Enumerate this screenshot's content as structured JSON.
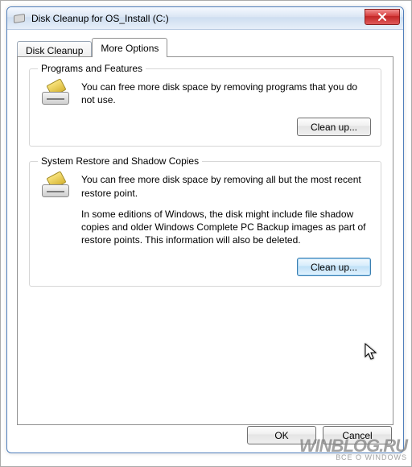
{
  "window": {
    "title": "Disk Cleanup for OS_Install (C:)"
  },
  "tabs": {
    "inactive_label": "Disk Cleanup",
    "active_label": "More Options"
  },
  "group_programs": {
    "legend": "Programs and Features",
    "text": "You can free more disk space by removing programs that you do not use.",
    "button": "Clean up..."
  },
  "group_restore": {
    "legend": "System Restore and Shadow Copies",
    "text1": "You can free more disk space by removing all but the most recent restore point.",
    "text2": "In some editions of Windows, the disk might include file shadow copies and older Windows Complete PC Backup images as part of restore points. This information will also be deleted.",
    "button": "Clean up..."
  },
  "dialog_buttons": {
    "ok": "OK",
    "cancel": "Cancel"
  },
  "watermark": {
    "brand": "WINBLOG.RU",
    "tagline": "ВСЕ О WINDOWS"
  }
}
